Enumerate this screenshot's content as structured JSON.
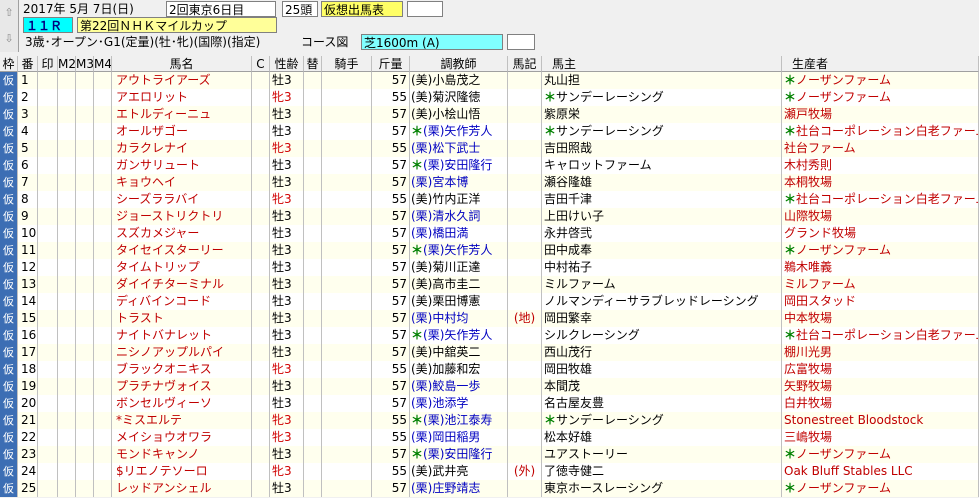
{
  "header": {
    "date": "2017年 5月 7日(日)",
    "meeting": "2回東京6日目",
    "heads": "25頭",
    "mode_label": "仮想出馬表",
    "race_no": "１１Ｒ",
    "race_name": "第22回ＮＨＫマイルカップ",
    "conditions": "3歳･オープン･G1(定量)(牡･牝)(国際)(指定)",
    "course_button": "コース図",
    "course": "芝1600m (A)"
  },
  "nav": {
    "up": "⇧",
    "down": "⇩"
  },
  "columns": {
    "waku": "枠",
    "ban": "番",
    "shirushi": "印",
    "m2": "M2",
    "m3": "M3",
    "m4": "M4",
    "name": "馬名",
    "c": "C",
    "sexage": "性齢",
    "sub": "替",
    "jockey": "騎手",
    "weight": "斤量",
    "trainer": "調教師",
    "kigou": "馬記",
    "owner": "馬主",
    "breeder": "生産者"
  },
  "colors": {
    "waku_bg": "#3c6eb4",
    "horse_name": "#c00000",
    "kuri": "#0000c0"
  },
  "rows": [
    {
      "waku": "仮",
      "ban": "1",
      "name": "アウトライアーズ",
      "sex": "牡3",
      "f": false,
      "w": "57",
      "tr": "(美)小島茂之",
      "kuri": false,
      "tm": "",
      "kg": "",
      "om": "",
      "owner": "丸山担",
      "bm": "＊",
      "breeder": "ノーザンファーム"
    },
    {
      "waku": "仮",
      "ban": "2",
      "name": "アエロリット",
      "sex": "牝3",
      "f": true,
      "w": "55",
      "tr": "(美)菊沢隆徳",
      "kuri": false,
      "tm": "",
      "kg": "",
      "om": "＊",
      "owner": "サンデーレーシング",
      "bm": "＊",
      "breeder": "ノーザンファーム"
    },
    {
      "waku": "仮",
      "ban": "3",
      "name": "エトルディーニュ",
      "sex": "牡3",
      "f": false,
      "w": "57",
      "tr": "(美)小桧山悟",
      "kuri": false,
      "tm": "",
      "kg": "",
      "om": "",
      "owner": "紫原栄",
      "bm": "",
      "breeder": "瀬戸牧場"
    },
    {
      "waku": "仮",
      "ban": "4",
      "name": "オールザゴー",
      "sex": "牡3",
      "f": false,
      "w": "57",
      "tr": "(栗)矢作芳人",
      "kuri": true,
      "tm": "＊",
      "kg": "",
      "om": "＊",
      "owner": "サンデーレーシング",
      "bm": "＊",
      "breeder": "社台コーポレーション白老ファーム"
    },
    {
      "waku": "仮",
      "ban": "5",
      "name": "カラクレナイ",
      "sex": "牝3",
      "f": true,
      "w": "55",
      "tr": "(栗)松下武士",
      "kuri": true,
      "tm": "",
      "kg": "",
      "om": "",
      "owner": "吉田照哉",
      "bm": "",
      "breeder": "社台ファーム"
    },
    {
      "waku": "仮",
      "ban": "6",
      "name": "ガンサリュート",
      "sex": "牡3",
      "f": false,
      "w": "57",
      "tr": "(栗)安田隆行",
      "kuri": true,
      "tm": "＊",
      "kg": "",
      "om": "",
      "owner": "キャロットファーム",
      "bm": "",
      "breeder": "木村秀則"
    },
    {
      "waku": "仮",
      "ban": "7",
      "name": "キョウヘイ",
      "sex": "牡3",
      "f": false,
      "w": "57",
      "tr": "(栗)宮本博",
      "kuri": true,
      "tm": "",
      "kg": "",
      "om": "",
      "owner": "瀬谷隆雄",
      "bm": "",
      "breeder": "本桐牧場"
    },
    {
      "waku": "仮",
      "ban": "8",
      "name": "シーズララバイ",
      "sex": "牝3",
      "f": true,
      "w": "55",
      "tr": "(美)竹内正洋",
      "kuri": false,
      "tm": "",
      "kg": "",
      "om": "",
      "owner": "吉田千津",
      "bm": "＊",
      "breeder": "社台コーポレーション白老ファーム"
    },
    {
      "waku": "仮",
      "ban": "9",
      "name": "ジョーストリクトリ",
      "sex": "牡3",
      "f": false,
      "w": "57",
      "tr": "(栗)清水久詞",
      "kuri": true,
      "tm": "",
      "kg": "",
      "om": "",
      "owner": "上田けい子",
      "bm": "",
      "breeder": "山際牧場"
    },
    {
      "waku": "仮",
      "ban": "10",
      "name": "スズカメジャー",
      "sex": "牡3",
      "f": false,
      "w": "57",
      "tr": "(栗)橋田満",
      "kuri": true,
      "tm": "",
      "kg": "",
      "om": "",
      "owner": "永井啓弐",
      "bm": "",
      "breeder": "グランド牧場"
    },
    {
      "waku": "仮",
      "ban": "11",
      "name": "タイセイスターリー",
      "sex": "牡3",
      "f": false,
      "w": "57",
      "tr": "(栗)矢作芳人",
      "kuri": true,
      "tm": "＊",
      "kg": "",
      "om": "",
      "owner": "田中成奉",
      "bm": "＊",
      "breeder": "ノーザンファーム"
    },
    {
      "waku": "仮",
      "ban": "12",
      "name": "タイムトリップ",
      "sex": "牡3",
      "f": false,
      "w": "57",
      "tr": "(美)菊川正達",
      "kuri": false,
      "tm": "",
      "kg": "",
      "om": "",
      "owner": "中村祐子",
      "bm": "",
      "breeder": "鵜木唯義"
    },
    {
      "waku": "仮",
      "ban": "13",
      "name": "ダイイチターミナル",
      "sex": "牡3",
      "f": false,
      "w": "57",
      "tr": "(美)高市圭二",
      "kuri": false,
      "tm": "",
      "kg": "",
      "om": "",
      "owner": "ミルファーム",
      "bm": "",
      "breeder": "ミルファーム"
    },
    {
      "waku": "仮",
      "ban": "14",
      "name": "ディバインコード",
      "sex": "牡3",
      "f": false,
      "w": "57",
      "tr": "(美)栗田博憲",
      "kuri": false,
      "tm": "",
      "kg": "",
      "om": "",
      "owner": "ノルマンディーサラブレッドレーシング",
      "bm": "",
      "breeder": "岡田スタッド"
    },
    {
      "waku": "仮",
      "ban": "15",
      "name": "トラスト",
      "sex": "牡3",
      "f": false,
      "w": "57",
      "tr": "(栗)中村均",
      "kuri": true,
      "tm": "",
      "kg": "(地)",
      "om": "",
      "owner": "岡田繁幸",
      "bm": "",
      "breeder": "中本牧場"
    },
    {
      "waku": "仮",
      "ban": "16",
      "name": "ナイトバナレット",
      "sex": "牡3",
      "f": false,
      "w": "57",
      "tr": "(栗)矢作芳人",
      "kuri": true,
      "tm": "＊",
      "kg": "",
      "om": "",
      "owner": "シルクレーシング",
      "bm": "＊",
      "breeder": "社台コーポレーション白老ファーム"
    },
    {
      "waku": "仮",
      "ban": "17",
      "name": "ニシノアップルパイ",
      "sex": "牡3",
      "f": false,
      "w": "57",
      "tr": "(美)中舘英二",
      "kuri": false,
      "tm": "",
      "kg": "",
      "om": "",
      "owner": "西山茂行",
      "bm": "",
      "breeder": "棚川光男"
    },
    {
      "waku": "仮",
      "ban": "18",
      "name": "ブラックオニキス",
      "sex": "牝3",
      "f": true,
      "w": "55",
      "tr": "(美)加藤和宏",
      "kuri": false,
      "tm": "",
      "kg": "",
      "om": "",
      "owner": "岡田牧雄",
      "bm": "",
      "breeder": "広富牧場"
    },
    {
      "waku": "仮",
      "ban": "19",
      "name": "プラチナヴォイス",
      "sex": "牡3",
      "f": false,
      "w": "57",
      "tr": "(栗)鮫島一歩",
      "kuri": true,
      "tm": "",
      "kg": "",
      "om": "",
      "owner": "本間茂",
      "bm": "",
      "breeder": "矢野牧場"
    },
    {
      "waku": "仮",
      "ban": "20",
      "name": "ボンセルヴィーソ",
      "sex": "牡3",
      "f": false,
      "w": "57",
      "tr": "(栗)池添学",
      "kuri": true,
      "tm": "",
      "kg": "",
      "om": "",
      "owner": "名古屋友豊",
      "bm": "",
      "breeder": "白井牧場"
    },
    {
      "waku": "仮",
      "ban": "21",
      "name": "*ミスエルテ",
      "sex": "牝3",
      "f": true,
      "w": "55",
      "tr": "(栗)池江泰寿",
      "kuri": true,
      "tm": "＊",
      "kg": "",
      "om": "＊",
      "owner": "サンデーレーシング",
      "bm": "",
      "breeder": "Stonestreet Bloodstock"
    },
    {
      "waku": "仮",
      "ban": "22",
      "name": "メイショウオワラ",
      "sex": "牝3",
      "f": true,
      "w": "55",
      "tr": "(栗)岡田稲男",
      "kuri": true,
      "tm": "",
      "kg": "",
      "om": "",
      "owner": "松本好雄",
      "bm": "",
      "breeder": "三嶋牧場"
    },
    {
      "waku": "仮",
      "ban": "23",
      "name": "モンドキャンノ",
      "sex": "牡3",
      "f": false,
      "w": "57",
      "tr": "(栗)安田隆行",
      "kuri": true,
      "tm": "＊",
      "kg": "",
      "om": "",
      "owner": "ユアストーリー",
      "bm": "＊",
      "breeder": "ノーザンファーム"
    },
    {
      "waku": "仮",
      "ban": "24",
      "name": "$リエノテソーロ",
      "sex": "牝3",
      "f": true,
      "w": "55",
      "tr": "(美)武井亮",
      "kuri": false,
      "tm": "",
      "kg": "(外)",
      "om": "",
      "owner": "了徳寺健二",
      "bm": "",
      "breeder": "Oak Bluff Stables LLC"
    },
    {
      "waku": "仮",
      "ban": "25",
      "name": "レッドアンシェル",
      "sex": "牡3",
      "f": false,
      "w": "57",
      "tr": "(栗)庄野靖志",
      "kuri": true,
      "tm": "",
      "kg": "",
      "om": "",
      "owner": "東京ホースレーシング",
      "bm": "＊",
      "breeder": "ノーザンファーム"
    }
  ]
}
